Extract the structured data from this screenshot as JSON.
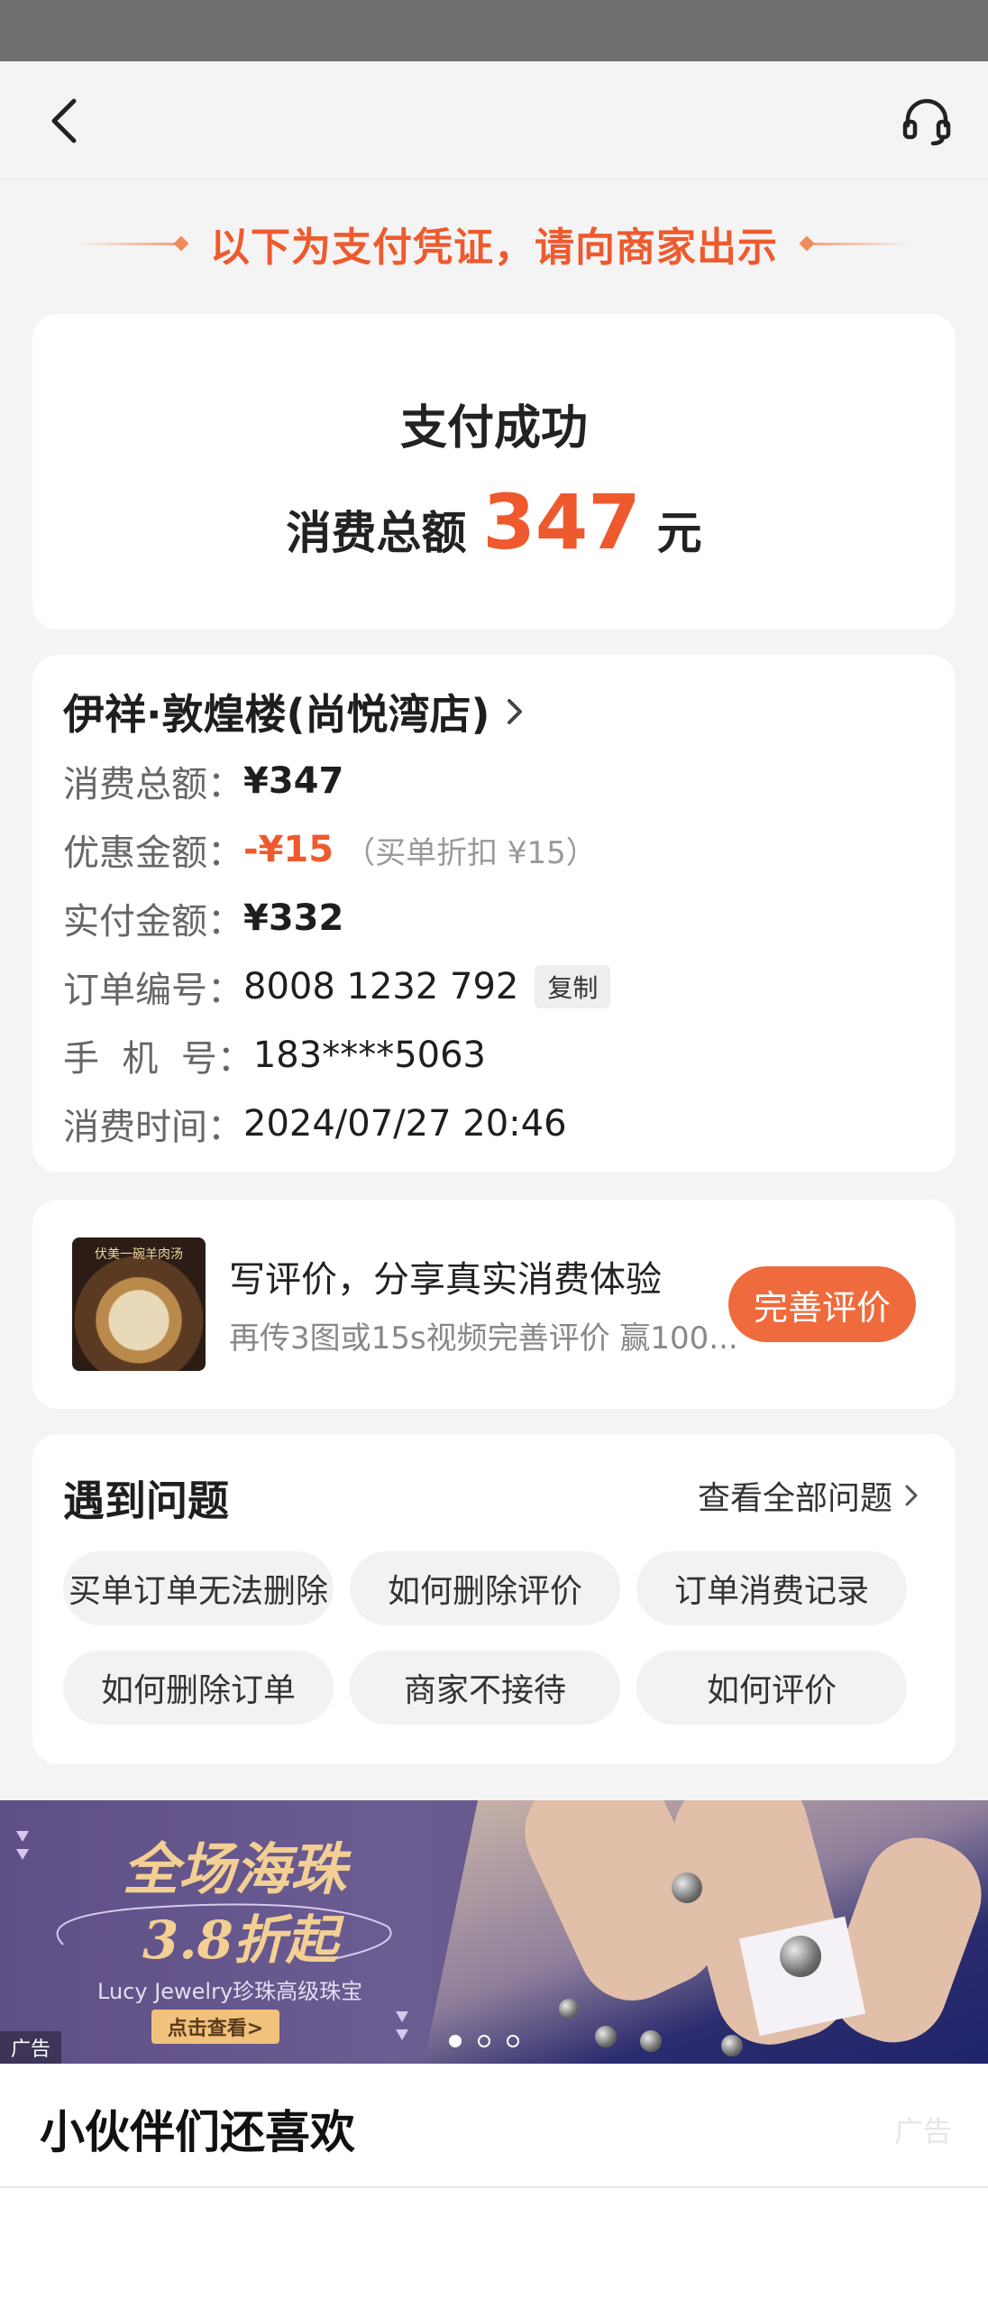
{
  "colors": {
    "accent": "#ee5a2e",
    "button": "#ef6a3c",
    "page_bg": "#f4f4f4"
  },
  "nav": {
    "back_icon": "chevron-left-icon",
    "service_icon": "headset-icon"
  },
  "banner": {
    "text": "以下为支付凭证，请向商家出示"
  },
  "success": {
    "title": "支付成功",
    "total_label": "消费总额",
    "total_amount": "347",
    "unit": "元"
  },
  "order": {
    "shop_name": "伊祥·敦煌楼(尚悦湾店)",
    "rows": [
      {
        "label": "消费总额：",
        "value": "¥347"
      },
      {
        "label": "优惠金额：",
        "value": "-¥15",
        "note": "（买单折扣 ¥15）"
      },
      {
        "label": "实付金额：",
        "value": "¥332"
      },
      {
        "label": "订单编号：",
        "value": "8008 1232 792",
        "action": "复制"
      },
      {
        "label": "手  机  号：",
        "value": "183****5063"
      },
      {
        "label": "消费时间：",
        "value": "2024/07/27 20:46"
      }
    ]
  },
  "review": {
    "image_caption": "伏美一碗羊肉汤",
    "title": "写评价，分享真实消费体验",
    "subtitle": "再传3图或15s视频完善评价 赢100...",
    "button": "完善评价"
  },
  "faq": {
    "title": "遇到问题",
    "view_all": "查看全部问题",
    "chips": [
      "买单订单无法删除",
      "如何删除评价",
      "订单消费记录",
      "如何删除订单",
      "商家不接待",
      "如何评价"
    ]
  },
  "ad": {
    "headline1": "全场海珠",
    "headline2": "3.8折起",
    "brand": "Lucy Jewelry珍珠高级珠宝",
    "cta": "点击查看>",
    "tag": "广告",
    "slides": 3,
    "active_slide": 1
  },
  "recommend": {
    "title": "小伙伴们还喜欢",
    "ad_label": "广告"
  }
}
